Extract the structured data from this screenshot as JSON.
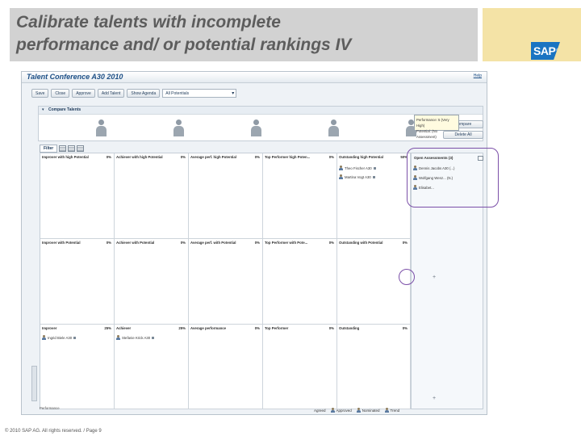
{
  "slide": {
    "title_line1": "Calibrate talents with incomplete",
    "title_line2": "performance and/ or potential rankings IV",
    "logo_text": "SAP",
    "logo_mark": "®",
    "footer": "© 2010 SAP AG. All rights reserved. / Page 9"
  },
  "app": {
    "title": "Talent Conference A30 2010",
    "help_link": "Help",
    "toolbar": {
      "buttons": [
        "Save",
        "Close",
        "Approve",
        "Add Talent",
        "Show Agenda"
      ],
      "select_value": "All Potentials"
    },
    "compare": {
      "header": "Compare Talents",
      "buttons": [
        "Compare",
        "Delete All"
      ]
    },
    "grid_toolbar": {
      "filter_label": "Filter"
    },
    "grid": {
      "rows": [
        [
          {
            "title": "Improver with high Potential",
            "pct": "0%"
          },
          {
            "title": "Achiever with high Potential",
            "pct": "0%"
          },
          {
            "title": "Average perf. high Potential",
            "pct": "0%"
          },
          {
            "title": "Top Performer high Poten...",
            "pct": "0%"
          },
          {
            "title": "Outstanding high Potential",
            "pct": "50%"
          }
        ],
        [
          {
            "title": "Improver with Potential",
            "pct": "0%"
          },
          {
            "title": "Achiever with Potential",
            "pct": "0%"
          },
          {
            "title": "Average perf. with Potential",
            "pct": "0%"
          },
          {
            "title": "Top Performer with Pote...",
            "pct": "0%"
          },
          {
            "title": "Outstanding with Potential",
            "pct": "0%"
          }
        ],
        [
          {
            "title": "Improver",
            "pct": "25%"
          },
          {
            "title": "Achiever",
            "pct": "25%"
          },
          {
            "title": "Average performance",
            "pct": "0%"
          },
          {
            "title": "Top Performer",
            "pct": "0%"
          },
          {
            "title": "Outstanding",
            "pct": "0%"
          }
        ]
      ],
      "entries": {
        "outstanding_high": [
          "Theo Fischer A30",
          "Martina Vogt A30"
        ],
        "improver": [
          "Ingrid Biele A30"
        ],
        "achiever": [
          "Stefanie Krick A30"
        ]
      },
      "performance_label": "Performance"
    },
    "right_panel": {
      "header": "Open Assessments (3)",
      "entries": [
        "Dennis Jacobs A30 (...)",
        "Wolfgang Wenz... (N.)",
        "Elisabet..."
      ],
      "tooltip_line1": "Performance: 5 (Very High)",
      "tooltip_line2": "Potential: (No Assessment)"
    },
    "legend": [
      "Agreed",
      "Approved",
      "Nominated",
      "Trend"
    ]
  }
}
